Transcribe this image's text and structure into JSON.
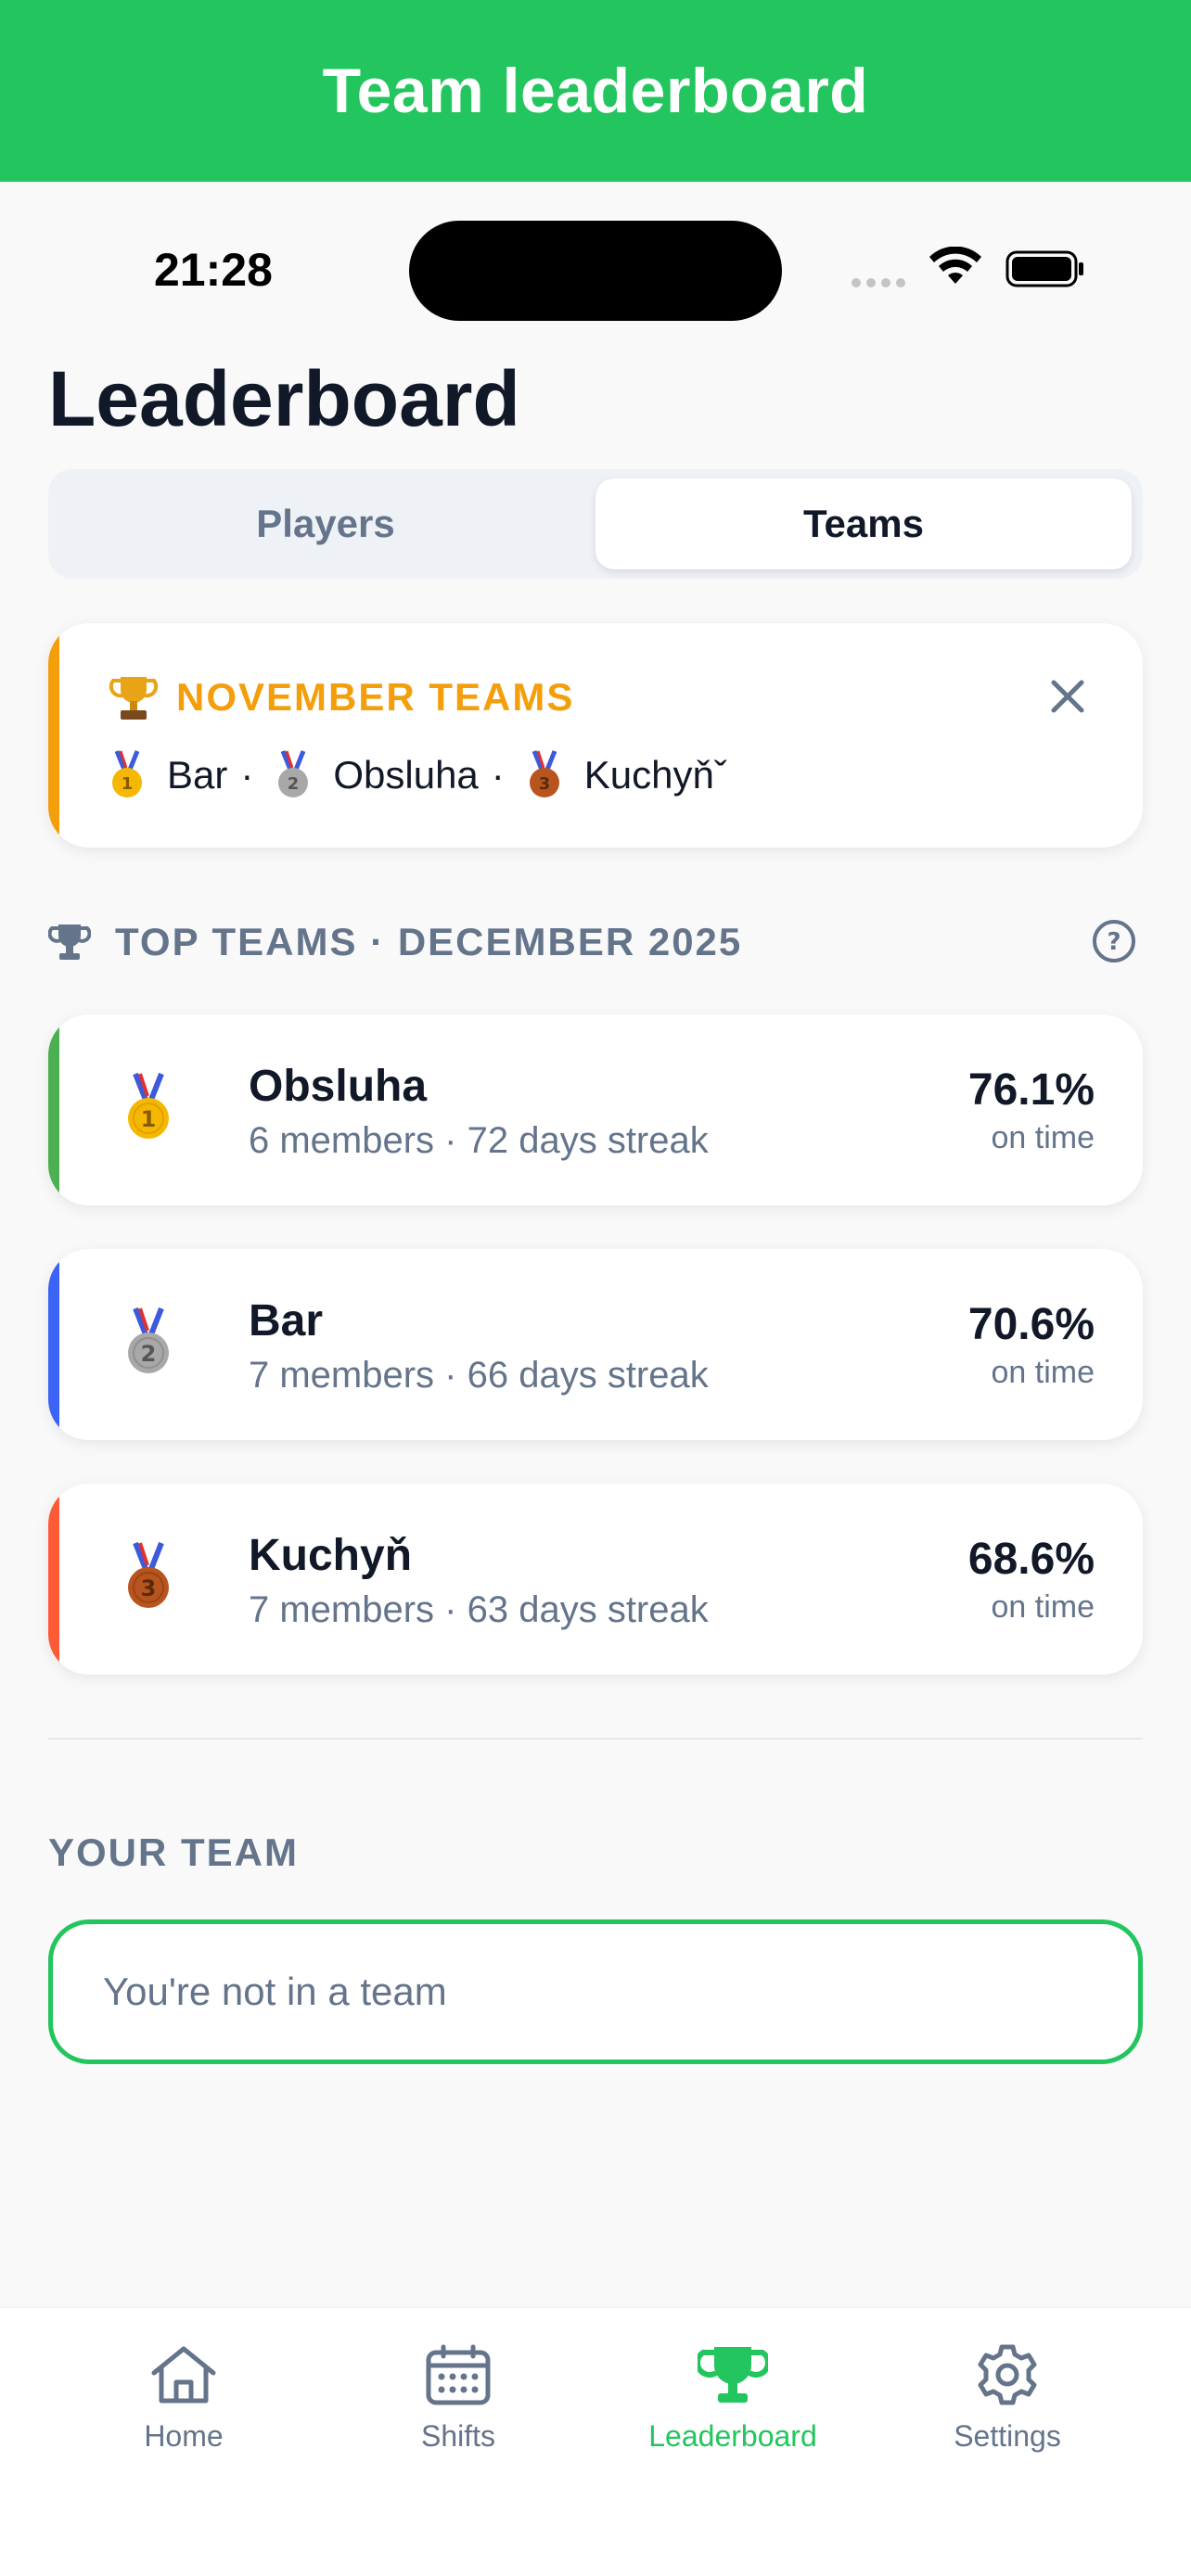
{
  "banner": {
    "title": "Team leaderboard"
  },
  "status_bar": {
    "time": "21:28"
  },
  "page": {
    "title": "Leaderboard"
  },
  "segments": {
    "players": "Players",
    "teams": "Teams",
    "selected": "Teams"
  },
  "notice": {
    "title": "NOVEMBER TEAMS",
    "first": "Bar",
    "second": "Obsluha",
    "third": "Kuchyňˇ",
    "sep": "·"
  },
  "top_teams": {
    "heading": "TOP TEAMS · DECEMBER 2025",
    "teams": [
      {
        "name": "Obsluha",
        "subtitle": "6 members · 72 days streak",
        "percent": "76.1%",
        "percent_label": "on time",
        "accent": "#4caf50",
        "rank": "1"
      },
      {
        "name": "Bar",
        "subtitle": "7 members · 66 days streak",
        "percent": "70.6%",
        "percent_label": "on time",
        "accent": "#3b63f6",
        "rank": "2"
      },
      {
        "name": "Kuchyň",
        "subtitle": "7 members · 63 days streak",
        "percent": "68.6%",
        "percent_label": "on time",
        "accent": "#ff5a36",
        "rank": "3"
      }
    ]
  },
  "your_team": {
    "label": "YOUR TEAM",
    "empty_text": "You're not in a team"
  },
  "tabbar": {
    "items": [
      {
        "label": "Home",
        "icon": "home-icon"
      },
      {
        "label": "Shifts",
        "icon": "calendar-icon"
      },
      {
        "label": "Leaderboard",
        "icon": "trophy-icon",
        "active": true
      },
      {
        "label": "Settings",
        "icon": "gear-icon"
      }
    ]
  },
  "colors": {
    "brand": "#22c55e",
    "gold": "#f59e0b",
    "muted": "#64748b"
  }
}
